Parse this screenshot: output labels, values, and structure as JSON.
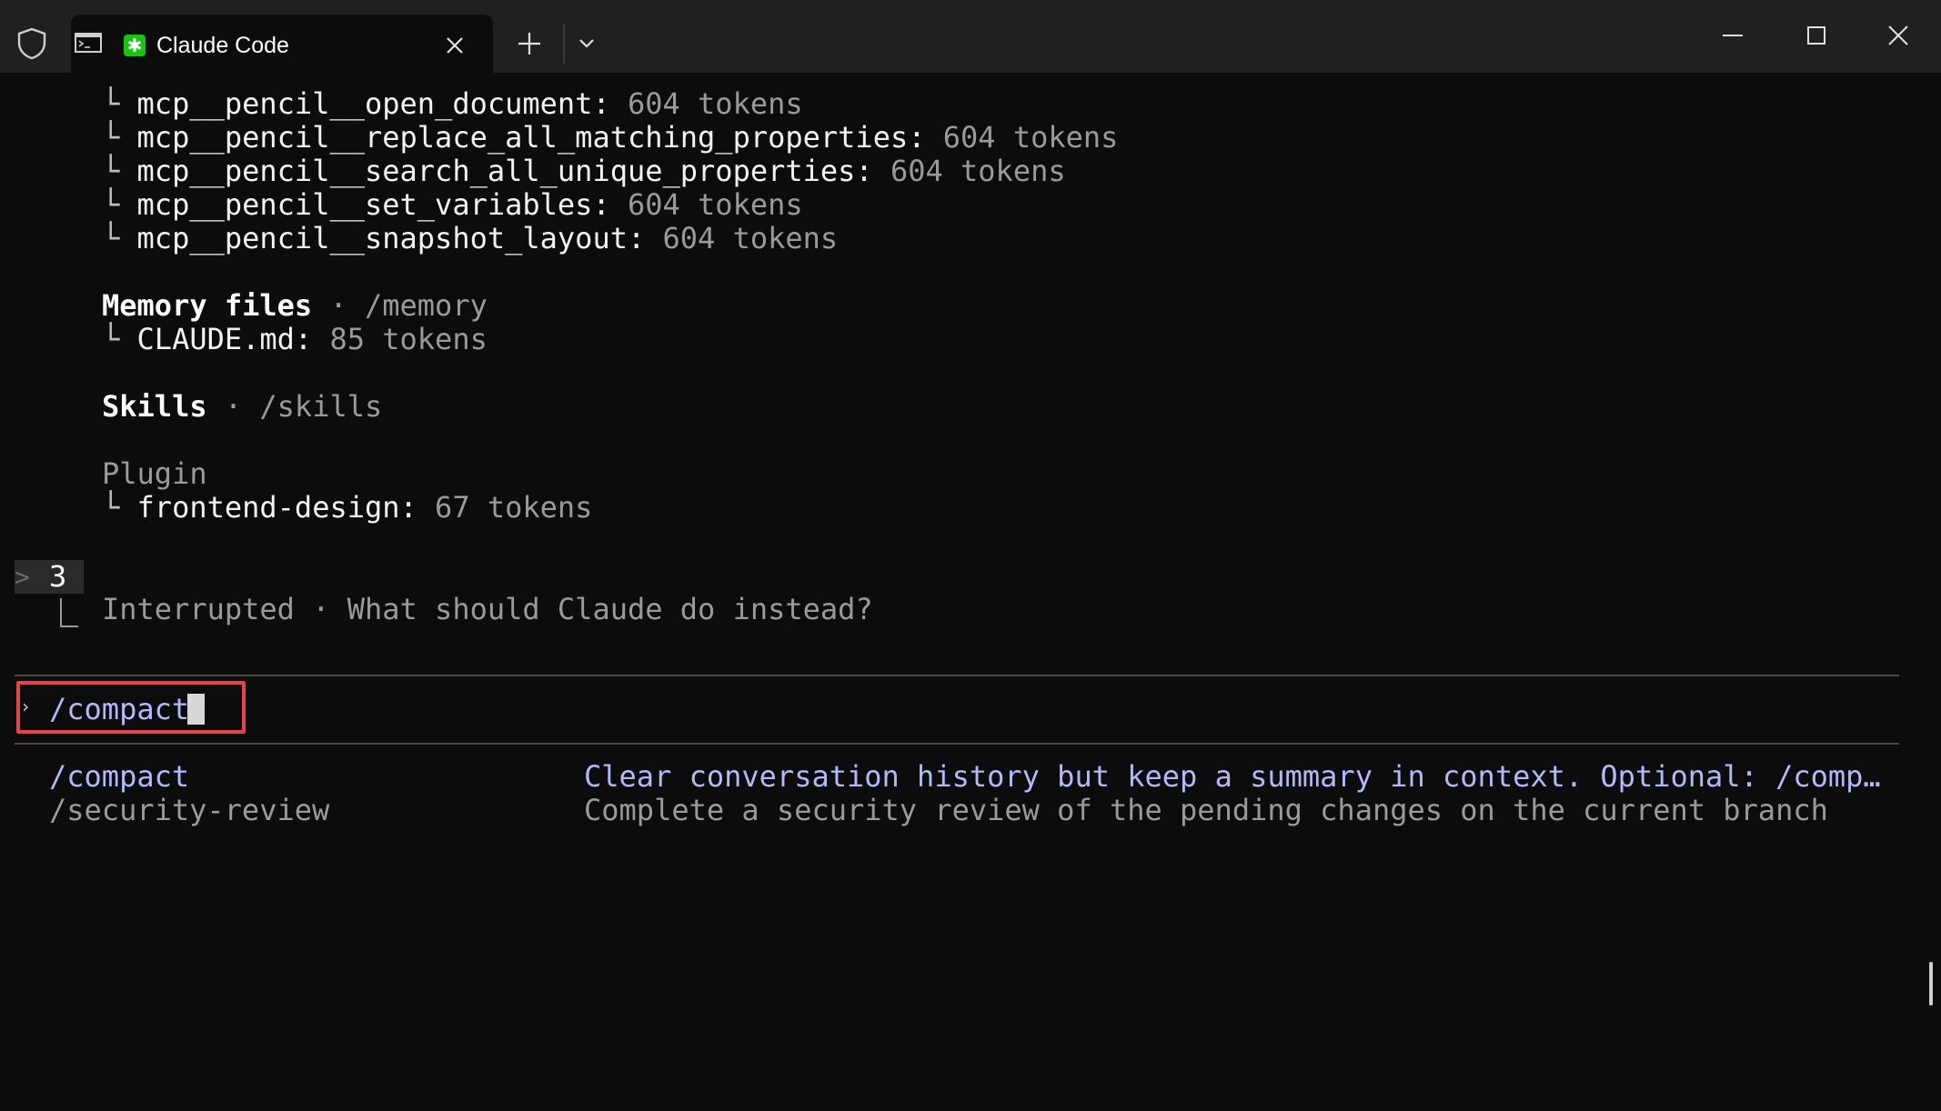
{
  "window": {
    "tab_title": "Claude Code",
    "app_icon_glyph": "✱",
    "accent_color": "#16c60c"
  },
  "context": {
    "tools": [
      {
        "name": "mcp__pencil__open_document",
        "tokens": "604 tokens"
      },
      {
        "name": "mcp__pencil__replace_all_matching_properties",
        "tokens": "604 tokens"
      },
      {
        "name": "mcp__pencil__search_all_unique_properties",
        "tokens": "604 tokens"
      },
      {
        "name": "mcp__pencil__set_variables",
        "tokens": "604 tokens"
      },
      {
        "name": "mcp__pencil__snapshot_layout",
        "tokens": "604 tokens"
      }
    ],
    "tree_glyph": "└",
    "memory": {
      "title": "Memory files",
      "separator": "·",
      "command": "/memory",
      "item": "CLAUDE.md:",
      "tokens": "85 tokens"
    },
    "skills": {
      "title": "Skills",
      "separator": "·",
      "command": "/skills"
    },
    "plugin": {
      "title": "Plugin",
      "item": "frontend-design:",
      "tokens": "67 tokens"
    }
  },
  "history": {
    "prompt_glyph": ">",
    "user_input": "3",
    "status": "Interrupted",
    "separator": "·",
    "question": "What should Claude do instead?"
  },
  "input": {
    "caret": "›",
    "value": "/compact",
    "highlight_color": "#e8424b"
  },
  "suggestions": [
    {
      "command": "/compact",
      "description": "Clear conversation history but keep a summary in context. Optional: /comp…",
      "selected": true
    },
    {
      "command": "/security-review",
      "description": "Complete a security review of the pending changes on the current branch",
      "selected": false
    }
  ]
}
